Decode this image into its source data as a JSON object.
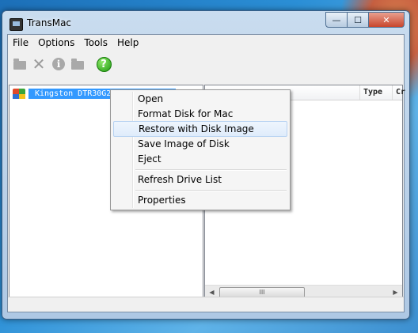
{
  "window": {
    "title": "TransMac"
  },
  "caption_buttons": {
    "minimize": "—",
    "maximize": "☐",
    "close": "✕"
  },
  "menubar": [
    "File",
    "Options",
    "Tools",
    "Help"
  ],
  "toolbar": {
    "icons": [
      "folder-icon",
      "delete-icon",
      "info-icon",
      "folder-icon",
      "help-icon"
    ],
    "info_glyph": "i",
    "help_glyph": "?",
    "delete_glyph": "✕"
  },
  "left_pane": {
    "drive_label": "Kingston DTR30G2 USB Device"
  },
  "right_pane": {
    "columns": [
      "Type",
      "Cr"
    ],
    "scroll": {
      "left": "◀",
      "thumb": "III",
      "right": "▶"
    }
  },
  "context_menu": {
    "items": [
      "Open",
      "Format Disk for Mac",
      "Restore with Disk Image",
      "Save Image of Disk",
      "Eject",
      "Refresh Drive List",
      "Properties"
    ],
    "highlighted": "Restore with Disk Image"
  }
}
